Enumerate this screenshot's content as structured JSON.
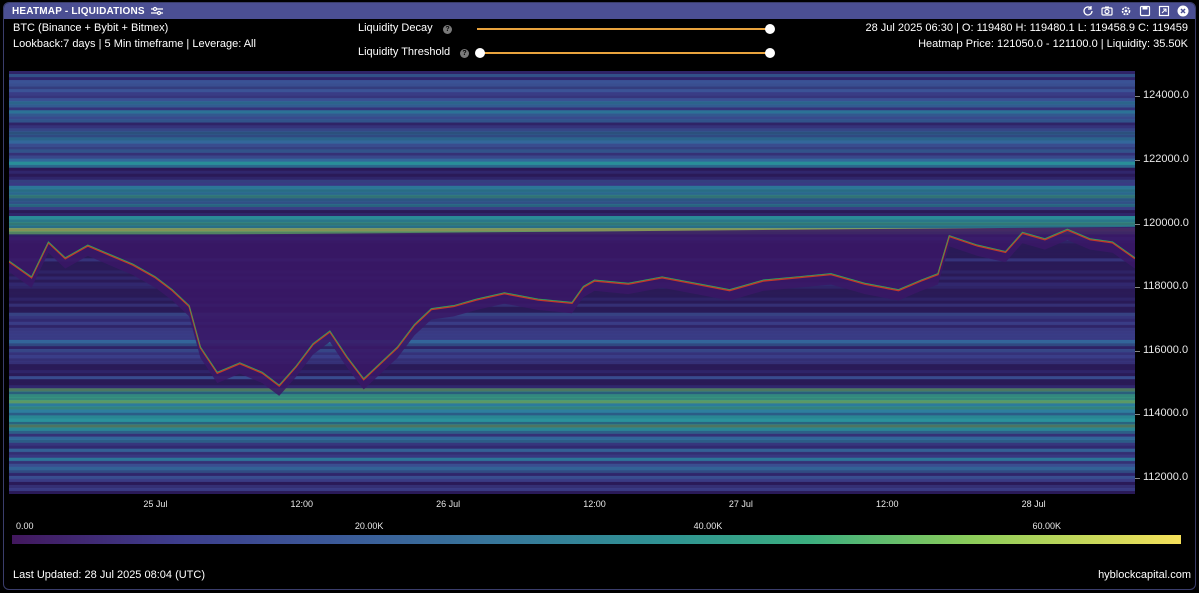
{
  "window": {
    "title": "HEATMAP - LIQUIDATIONS",
    "icons": [
      "refresh-icon",
      "camera-icon",
      "gear-icon",
      "save-icon",
      "expand-icon",
      "close-icon"
    ]
  },
  "info": {
    "exchanges": "BTC (Binance + Bybit + Bitmex)",
    "settings_line": "Lookback:7 days | 5 Min timeframe | Leverage: All",
    "ohlc": "28 Jul 2025 06:30 | O: 119480 H: 119480.1 L: 119458.9 C: 119459",
    "heatmap_line": "Heatmap Price: 121050.0 - 121100.0 | Liquidity: 35.50K"
  },
  "controls": {
    "decay": {
      "label": "Liquidity Decay",
      "help": "?",
      "value": 1.0
    },
    "threshold": {
      "label": "Liquidity Threshold",
      "help": "?",
      "range": [
        0.0,
        1.0
      ]
    }
  },
  "chart_data": {
    "type": "heatmap",
    "x_labels": [
      "25 Jul",
      "12:00",
      "26 Jul",
      "12:00",
      "27 Jul",
      "12:00",
      "28 Jul"
    ],
    "y_labels": [
      "124000.0",
      "122000.0",
      "120000.0",
      "118000.0",
      "116000.0",
      "114000.0",
      "112000.0"
    ],
    "y_range": [
      111500,
      124800
    ],
    "colorbar": {
      "labels": [
        "0.00",
        "20.00K",
        "40.00K",
        "60.00K"
      ],
      "range": [
        0,
        69000
      ]
    },
    "price_series": [
      {
        "t": 0.0,
        "p": 118800
      },
      {
        "t": 0.02,
        "p": 118300
      },
      {
        "t": 0.035,
        "p": 119400
      },
      {
        "t": 0.05,
        "p": 118900
      },
      {
        "t": 0.07,
        "p": 119300
      },
      {
        "t": 0.09,
        "p": 119000
      },
      {
        "t": 0.11,
        "p": 118700
      },
      {
        "t": 0.13,
        "p": 118300
      },
      {
        "t": 0.145,
        "p": 117900
      },
      {
        "t": 0.16,
        "p": 117400
      },
      {
        "t": 0.17,
        "p": 116100
      },
      {
        "t": 0.185,
        "p": 115300
      },
      {
        "t": 0.205,
        "p": 115600
      },
      {
        "t": 0.225,
        "p": 115300
      },
      {
        "t": 0.24,
        "p": 114900
      },
      {
        "t": 0.255,
        "p": 115500
      },
      {
        "t": 0.27,
        "p": 116200
      },
      {
        "t": 0.285,
        "p": 116600
      },
      {
        "t": 0.3,
        "p": 115800
      },
      {
        "t": 0.315,
        "p": 115100
      },
      {
        "t": 0.33,
        "p": 115600
      },
      {
        "t": 0.345,
        "p": 116100
      },
      {
        "t": 0.36,
        "p": 116800
      },
      {
        "t": 0.375,
        "p": 117300
      },
      {
        "t": 0.395,
        "p": 117400
      },
      {
        "t": 0.415,
        "p": 117600
      },
      {
        "t": 0.44,
        "p": 117800
      },
      {
        "t": 0.47,
        "p": 117600
      },
      {
        "t": 0.5,
        "p": 117500
      },
      {
        "t": 0.51,
        "p": 118000
      },
      {
        "t": 0.52,
        "p": 118200
      },
      {
        "t": 0.55,
        "p": 118100
      },
      {
        "t": 0.58,
        "p": 118300
      },
      {
        "t": 0.61,
        "p": 118100
      },
      {
        "t": 0.64,
        "p": 117900
      },
      {
        "t": 0.67,
        "p": 118200
      },
      {
        "t": 0.7,
        "p": 118300
      },
      {
        "t": 0.73,
        "p": 118400
      },
      {
        "t": 0.76,
        "p": 118100
      },
      {
        "t": 0.79,
        "p": 117900
      },
      {
        "t": 0.81,
        "p": 118200
      },
      {
        "t": 0.825,
        "p": 118400
      },
      {
        "t": 0.835,
        "p": 119600
      },
      {
        "t": 0.86,
        "p": 119300
      },
      {
        "t": 0.885,
        "p": 119100
      },
      {
        "t": 0.9,
        "p": 119700
      },
      {
        "t": 0.92,
        "p": 119500
      },
      {
        "t": 0.94,
        "p": 119800
      },
      {
        "t": 0.96,
        "p": 119500
      },
      {
        "t": 0.98,
        "p": 119400
      },
      {
        "t": 1.0,
        "p": 118900
      }
    ]
  },
  "footer": {
    "updated": "Last Updated: 28 Jul 2025 08:04 (UTC)",
    "brand": "hyblockcapital.com"
  }
}
